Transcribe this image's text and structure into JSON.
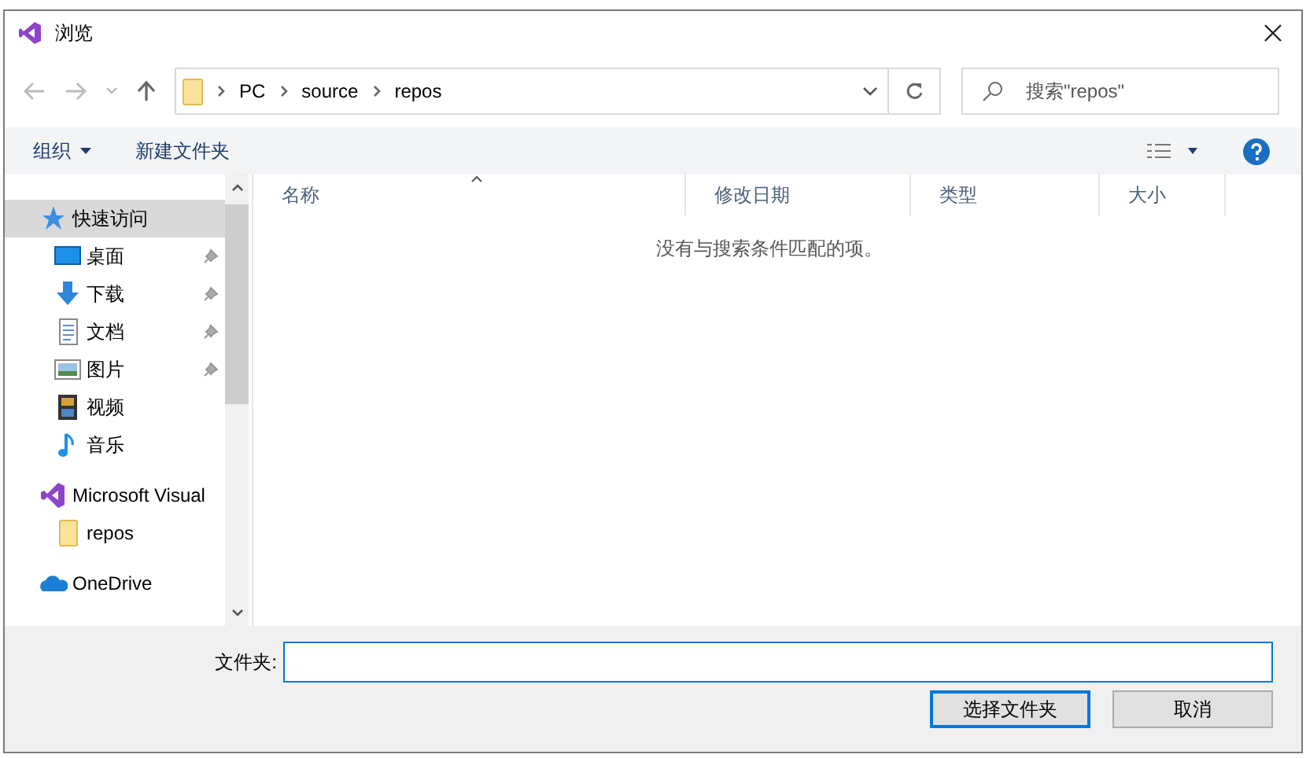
{
  "window": {
    "title": "浏览"
  },
  "address_bar": {
    "path": [
      "PC",
      "source",
      "repos"
    ]
  },
  "search": {
    "placeholder": "搜索\"repos\""
  },
  "toolbar": {
    "organize": "组织",
    "new_folder": "新建文件夹"
  },
  "sidebar": {
    "items": [
      {
        "label": "快速访问",
        "kind": "star",
        "pinned": false,
        "selected": true
      },
      {
        "label": "桌面",
        "kind": "desktop",
        "pinned": true,
        "selected": false
      },
      {
        "label": "下载",
        "kind": "download",
        "pinned": true,
        "selected": false
      },
      {
        "label": "文档",
        "kind": "document",
        "pinned": true,
        "selected": false
      },
      {
        "label": "图片",
        "kind": "pictures",
        "pinned": true,
        "selected": false
      },
      {
        "label": "视频",
        "kind": "video",
        "pinned": false,
        "selected": false
      },
      {
        "label": "音乐",
        "kind": "music",
        "pinned": false,
        "selected": false
      },
      {
        "label": "Microsoft Visual",
        "kind": "vs",
        "pinned": false,
        "selected": false
      },
      {
        "label": "repos",
        "kind": "folder",
        "pinned": false,
        "selected": false
      },
      {
        "label": "OneDrive",
        "kind": "cloud",
        "pinned": false,
        "selected": false
      }
    ]
  },
  "table": {
    "columns": [
      "名称",
      "修改日期",
      "类型",
      "大小"
    ],
    "empty_message": "没有与搜索条件匹配的项。"
  },
  "folder_field": {
    "label": "文件夹:"
  },
  "buttons": [
    {
      "label": "选择文件夹",
      "kind": "primary"
    },
    {
      "label": "取消",
      "kind": "secondary"
    }
  ]
}
